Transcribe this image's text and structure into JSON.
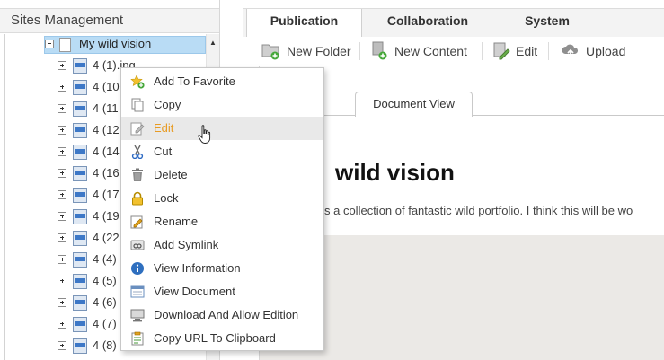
{
  "sites_panel": {
    "title": "Sites Management",
    "root_node": "My wild vision",
    "items": [
      {
        "label": "4 (1).jpg"
      },
      {
        "label": "4 (10"
      },
      {
        "label": "4 (11"
      },
      {
        "label": "4 (12"
      },
      {
        "label": "4 (14"
      },
      {
        "label": "4 (16"
      },
      {
        "label": "4 (17"
      },
      {
        "label": "4 (19"
      },
      {
        "label": "4 (22"
      },
      {
        "label": "4 (4)"
      },
      {
        "label": "4 (5)"
      },
      {
        "label": "4 (6)"
      },
      {
        "label": "4 (7)"
      },
      {
        "label": "4 (8)"
      }
    ]
  },
  "tabs": [
    {
      "label": "Publication",
      "active": true
    },
    {
      "label": "Collaboration",
      "active": false
    },
    {
      "label": "System",
      "active": false
    }
  ],
  "toolbar": {
    "new_folder": "New Folder",
    "new_content": "New Content",
    "edit": "Edit",
    "upload": "Upload"
  },
  "document": {
    "view_tab": "Document View",
    "title": "wild vision",
    "description": "s a collection of fantastic wild portfolio. I think this will be wo"
  },
  "context_menu": {
    "items": [
      {
        "label": "Add To Favorite",
        "icon": "star-add-icon"
      },
      {
        "label": "Copy",
        "icon": "copy-icon"
      },
      {
        "label": "Edit",
        "icon": "edit-icon",
        "hovered": true
      },
      {
        "label": "Cut",
        "icon": "scissors-icon"
      },
      {
        "label": "Delete",
        "icon": "trash-icon"
      },
      {
        "label": "Lock",
        "icon": "lock-icon"
      },
      {
        "label": "Rename",
        "icon": "rename-icon"
      },
      {
        "label": "Add Symlink",
        "icon": "symlink-icon"
      },
      {
        "label": "View Information",
        "icon": "info-icon"
      },
      {
        "label": "View Document",
        "icon": "view-document-icon"
      },
      {
        "label": "Download And Allow Edition",
        "icon": "download-icon"
      },
      {
        "label": "Copy URL To Clipboard",
        "icon": "clipboard-icon"
      }
    ]
  },
  "colors": {
    "hover_text": "#e89b23",
    "hover_bg": "#e9e9e9",
    "selected_node_bg": "#b9dcf5",
    "panel_header_bg": "#f3f3f3",
    "document_area_bg": "#ebe9e6"
  }
}
